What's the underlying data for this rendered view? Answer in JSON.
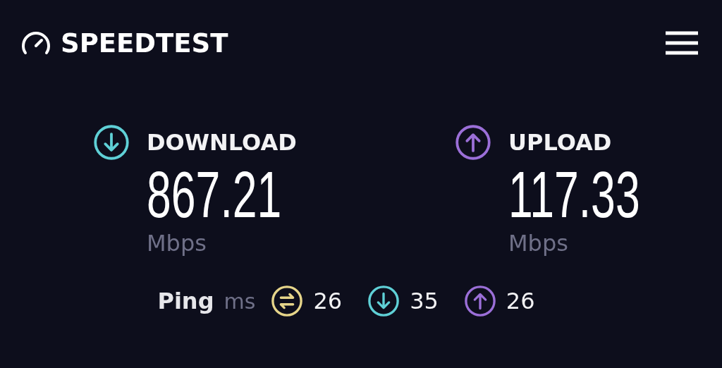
{
  "header": {
    "title": "SPEEDTEST"
  },
  "results": [
    {
      "kind": "download",
      "label": "DOWNLOAD",
      "value": "867.21",
      "unit": "Mbps",
      "color": "#5fd0d6"
    },
    {
      "kind": "upload",
      "label": "UPLOAD",
      "value": "117.33",
      "unit": "Mbps",
      "color": "#9b6fd8"
    }
  ],
  "ping": {
    "label": "Ping",
    "unit": "ms",
    "readings": [
      {
        "kind": "idle",
        "value": "26",
        "color": "#e6d58a"
      },
      {
        "kind": "download",
        "value": "35",
        "color": "#5fd0d6"
      },
      {
        "kind": "upload",
        "value": "26",
        "color": "#9b6fd8"
      }
    ]
  }
}
